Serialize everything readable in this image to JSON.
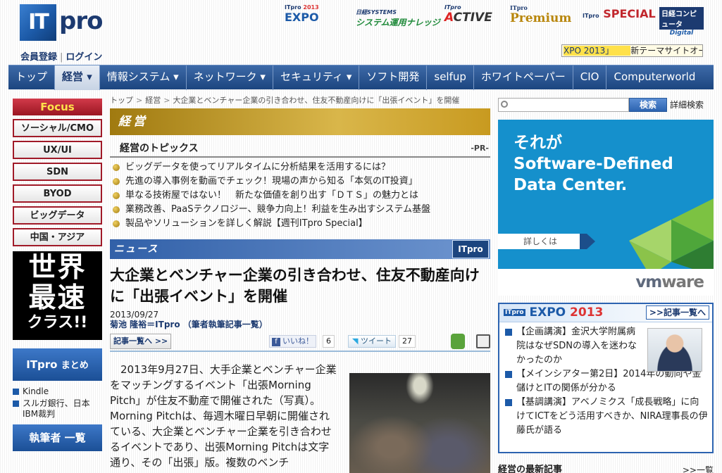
{
  "header": {
    "logo_mark": "IT",
    "logo_word": "pro",
    "register": "会員登録",
    "login": "ログイン",
    "brands": {
      "expo_small": "ITpro",
      "expo_year": "2013",
      "expo": "EXPO",
      "knowledge_small": "日経SYSTEMS",
      "knowledge": "システム運用ナレッジ",
      "active_small": "ITpro",
      "active_a": "A",
      "active_rest": "CTIVE",
      "premium_small": "ITpro",
      "premium": "Premium",
      "special_small": "ITpro",
      "special": "SPECIAL",
      "computer_small": "日経",
      "computer": "コンピュータ",
      "computer_digital": "Digital"
    },
    "ticker": {
      "item1": "XPO 2013」",
      "item2": "新テーマサイトオー"
    }
  },
  "nav": {
    "items": [
      {
        "label": "トップ"
      },
      {
        "label": "経営 ▾"
      },
      {
        "label": "情報システム ▾"
      },
      {
        "label": "ネットワーク ▾"
      },
      {
        "label": "セキュリティ ▾"
      },
      {
        "label": "ソフト開発"
      },
      {
        "label": "selfup"
      },
      {
        "label": "ホワイトペーパー"
      },
      {
        "label": "CIO"
      },
      {
        "label": "Computerworld"
      }
    ]
  },
  "left": {
    "focus_title": "Focus",
    "focus_items": [
      "ソーシャル/CMO",
      "UX/UI",
      "SDN",
      "BYOD",
      "ビッグデータ",
      "中国・アジア"
    ],
    "promo_line1": "世界",
    "promo_line2": "最速",
    "promo_line3": "クラス!!",
    "matome_it": "ITpro",
    "matome": "まとめ",
    "matome_items": [
      "Kindle",
      "スルガ銀行、日本IBM裁判"
    ],
    "authors": "執筆者 一覧"
  },
  "breadcrumb": {
    "top": "トップ",
    "section": "経営",
    "current": "大企業とベンチャー企業の引き合わせ、住友不動産向けに「出張イベント」を開催"
  },
  "section": {
    "title": "経営",
    "topics_title": "経営のトピックス",
    "pr": "-PR-",
    "topics": [
      "ビッグデータを使ってリアルタイムに分析結果を活用するには？",
      "先進の導入事例を動画でチェック！現場の声から知る「本気のIT投資」",
      "単なる技術屋ではない！　新たな価値を創り出す「ＤＴＳ」の魅力とは",
      "業務改善、PaaSテクノロジー、競争力向上！利益を生み出すシステム基盤",
      "製品やソリューションを詳しく解説【週刊ITpro Special】"
    ]
  },
  "news": {
    "bar": "ニュース",
    "badge": "ITpro"
  },
  "article": {
    "title": "大企業とベンチャー企業の引き合わせ、住友不動産向けに「出張イベント」を開催",
    "date": "2013/09/27",
    "author": "菊池 隆裕＝ITpro",
    "author_note": "（筆者執筆記事一覧）",
    "list_button": "記事一覧へ >>",
    "like_label": "いいね！",
    "like_count": "6",
    "tweet_label": "ツイート",
    "tweet_count": "27",
    "body": "2013年9月27日、大手企業とベンチャー企業をマッチングするイベント「出張Morning Pitch」が住友不動産で開催された（写真）。Morning Pitchは、毎週木曜日早朝に開催されている、大企業とベンチャー企業を引き合わせるイベントであり、出張Morning Pitchは文字通り、その「出張」版。複数のベンチ"
  },
  "right": {
    "search_placeholder": "",
    "search_button": "検索",
    "advanced_search": "詳細検索",
    "ad": {
      "line1": "それが",
      "line2": "Software-Defined",
      "line3": "Data Center.",
      "button": "詳しくは",
      "brand_vm": "vm",
      "brand_ware": "ware"
    },
    "expo": {
      "logo_it": "ITpro",
      "logo": "EXPO",
      "year": "2013",
      "more": ">>記事一覧へ",
      "items": [
        "【企画講演】金沢大学附属病院はなぜSDNの導入を迷わなかったのか",
        "【メインシアター第2日】2014年の動向や金儲けとITの関係が分かる",
        "【基調講演】アベノミクス「成長戦略」に向けてICTをどう活用すべきか、NIRA理事長の伊藤氏が語る"
      ]
    },
    "latest_title": "経営の最新記事",
    "latest_more": ">>一覧"
  },
  "colors": {
    "nav_blue": "#1c457f",
    "focus_red": "#a01a28",
    "section_gold": "#c89a20",
    "ad_blue": "#1590cc"
  }
}
